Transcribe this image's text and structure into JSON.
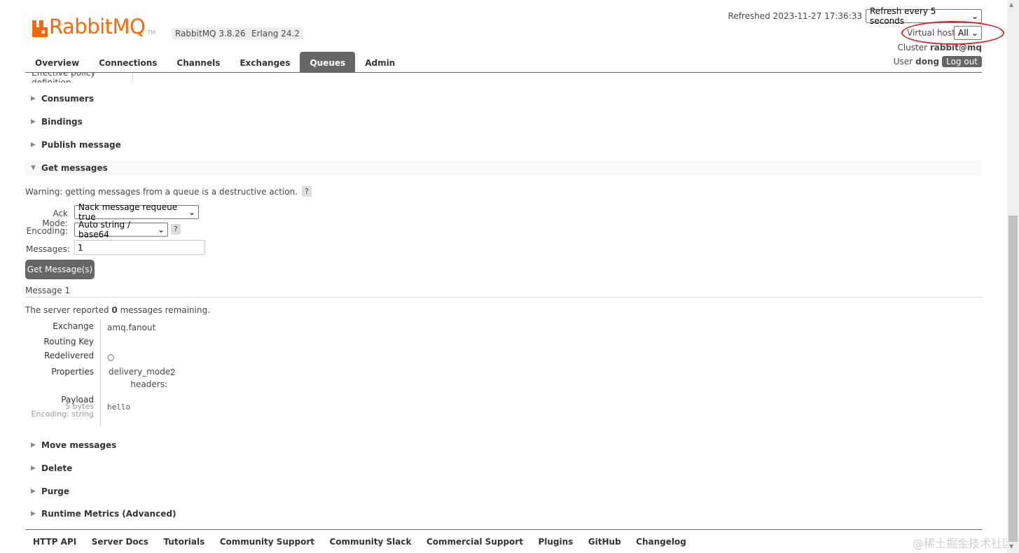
{
  "header": {
    "logo_text": "RabbitMQ",
    "logo_tm": "TM",
    "version": "RabbitMQ 3.8.26",
    "erlang": "Erlang 24.2",
    "refreshed": "Refreshed 2023-11-27 17:36:33",
    "refresh_select": "Refresh every 5 seconds",
    "vhost_label": "Virtual host",
    "vhost_select": "All",
    "cluster_label": "Cluster",
    "cluster_name": "rabbit@mq",
    "user_label": "User",
    "user_name": "dong",
    "logout": "Log out"
  },
  "tabs": [
    "Overview",
    "Connections",
    "Channels",
    "Exchanges",
    "Queues",
    "Admin"
  ],
  "active_tab": "Queues",
  "cutoff_text": "Effective policy definition",
  "sections_top": {
    "consumers": "Consumers",
    "bindings": "Bindings",
    "publish": "Publish message",
    "get": "Get messages"
  },
  "get_messages": {
    "warning": "Warning: getting messages from a queue is a destructive action.",
    "help": "?",
    "ack_label": "Ack Mode:",
    "ack_value": "Nack message requeue true",
    "encoding_label": "Encoding:",
    "encoding_value": "Auto string / base64",
    "messages_label": "Messages:",
    "messages_value": "1",
    "button": "Get Message(s)"
  },
  "message": {
    "title": "Message 1",
    "report_prefix": "The server reported",
    "report_count": "0",
    "report_suffix": "messages remaining.",
    "exchange_label": "Exchange",
    "exchange_value": "amq.fanout",
    "routing_key_label": "Routing Key",
    "routing_key_value": "",
    "redelivered_label": "Redelivered",
    "redelivered_value": "○",
    "properties_label": "Properties",
    "delivery_mode_label": "delivery_mode:",
    "delivery_mode_value": "2",
    "headers_label": "headers:",
    "payload_label": "Payload",
    "payload_size": "5 bytes",
    "payload_encoding": "Encoding: string",
    "payload_value": "hello"
  },
  "sections_bottom": {
    "move": "Move messages",
    "delete": "Delete",
    "purge": "Purge",
    "runtime": "Runtime Metrics (Advanced)"
  },
  "footer": [
    "HTTP API",
    "Server Docs",
    "Tutorials",
    "Community Support",
    "Community Slack",
    "Commercial Support",
    "Plugins",
    "GitHub",
    "Changelog"
  ],
  "watermark": "@稀土掘金技术社区",
  "colors": {
    "brand": "#ff6600",
    "tab_active": "#666666",
    "annotation": "#d9262a"
  }
}
